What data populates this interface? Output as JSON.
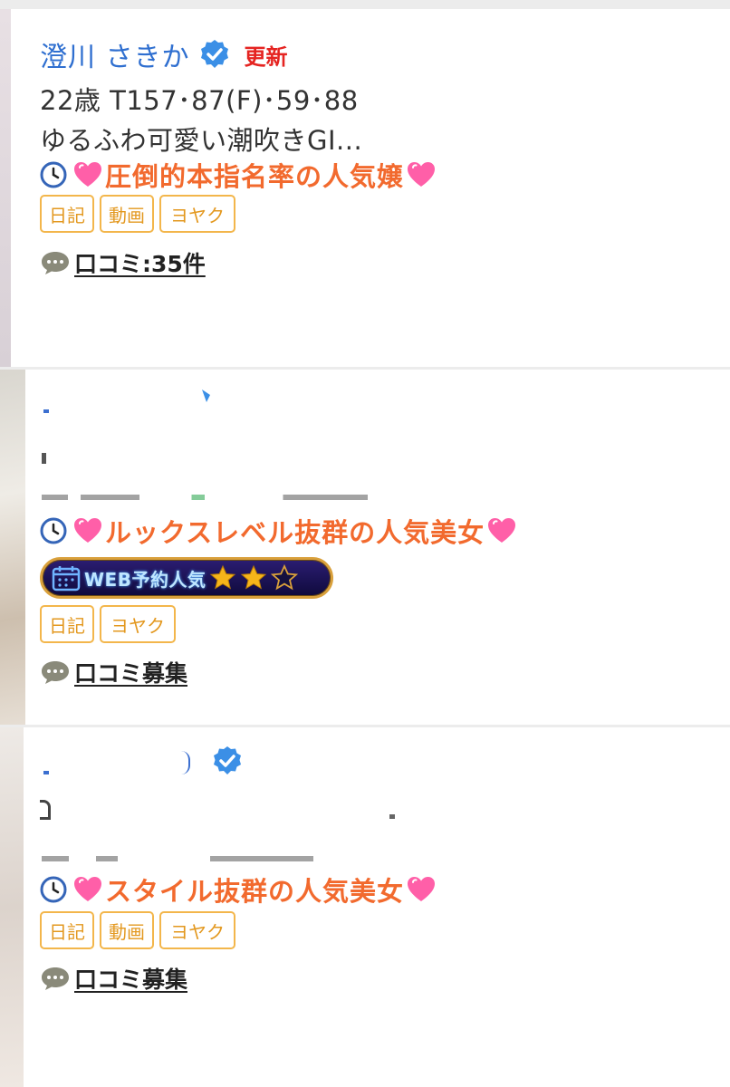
{
  "cards": [
    {
      "name": "澄川 さきか",
      "verified": true,
      "updated_label": "更新",
      "stats": "22歳 T157･87(F)･59･88",
      "description": "ゆるふわ可愛い潮吹きGI...",
      "catch": "圧倒的本指名率の人気嬢",
      "tags": [
        "日記",
        "動画",
        "ヨヤク"
      ],
      "review": "口コミ:35件"
    },
    {
      "catch": "ルックスレベル抜群の人気美女",
      "web_badge": {
        "label": "WEB予約人気",
        "stars_filled": 2,
        "stars_total": 3
      },
      "tags": [
        "日記",
        "ヨヤク"
      ],
      "review": "口コミ募集"
    },
    {
      "verified": true,
      "catch": "スタイル抜群の人気美女",
      "tags": [
        "日記",
        "動画",
        "ヨヤク"
      ],
      "review": "口コミ募集"
    }
  ],
  "colors": {
    "name": "#2f6fd0",
    "updated": "#e52421",
    "catch": "#f26a2e",
    "tag_border": "#f3b64b",
    "verified": "#3b8fe6"
  },
  "icons": [
    "verified-badge-icon",
    "clock-icon",
    "heart-icon",
    "speech-bubble-icon",
    "calendar-icon",
    "star-icon"
  ]
}
